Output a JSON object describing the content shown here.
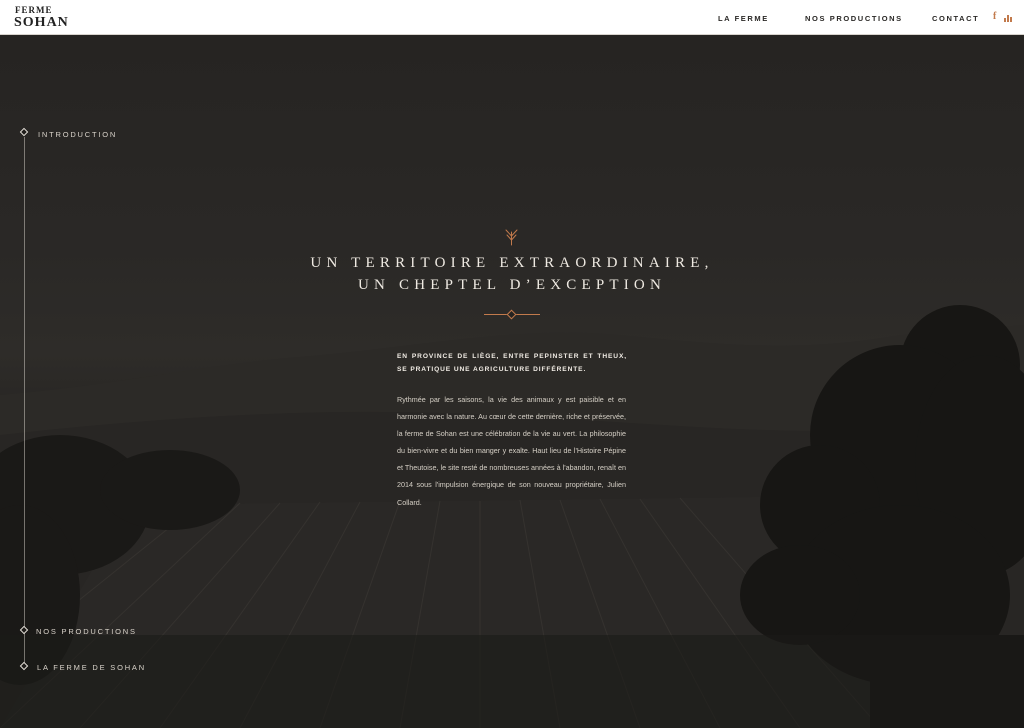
{
  "header": {
    "logo_line1": "FERME",
    "logo_line2": "SOHAN",
    "nav": [
      {
        "label": "LA FERME"
      },
      {
        "label": "NOS PRODUCTIONS"
      },
      {
        "label": "CONTACT"
      }
    ],
    "social_icons": [
      "facebook-icon",
      "bars-icon"
    ],
    "accent_color": "#c27a4c"
  },
  "side_nav": [
    {
      "label": "INTRODUCTION"
    },
    {
      "label": "NOS PRODUCTIONS"
    },
    {
      "label": "LA FERME DE SOHAN"
    }
  ],
  "hero": {
    "icon": "wheat-icon",
    "headline_line1": "UN TERRITOIRE EXTRAORDINAIRE,",
    "headline_line2": "UN CHEPTEL D’EXCEPTION",
    "lead": "EN PROVINCE DE LIÈGE, ENTRE PEPINSTER ET THEUX, SE PRATIQUE UNE AGRICULTURE DIFFÉRENTE.",
    "body": "Rythmée par les saisons, la vie des animaux y est paisible et en harmonie avec la nature. Au cœur de cette dernière, riche et préservée, la ferme de Sohan est une célébration de la vie au vert. La philosophie du bien-vivre et du bien manger y exalte. Haut lieu de l'Histoire Pépine et Theutoise, le site resté de nombreuses années à l'abandon, renaît en 2014 sous l'impulsion énergique de son nouveau propriétaire, Julien Collard."
  }
}
